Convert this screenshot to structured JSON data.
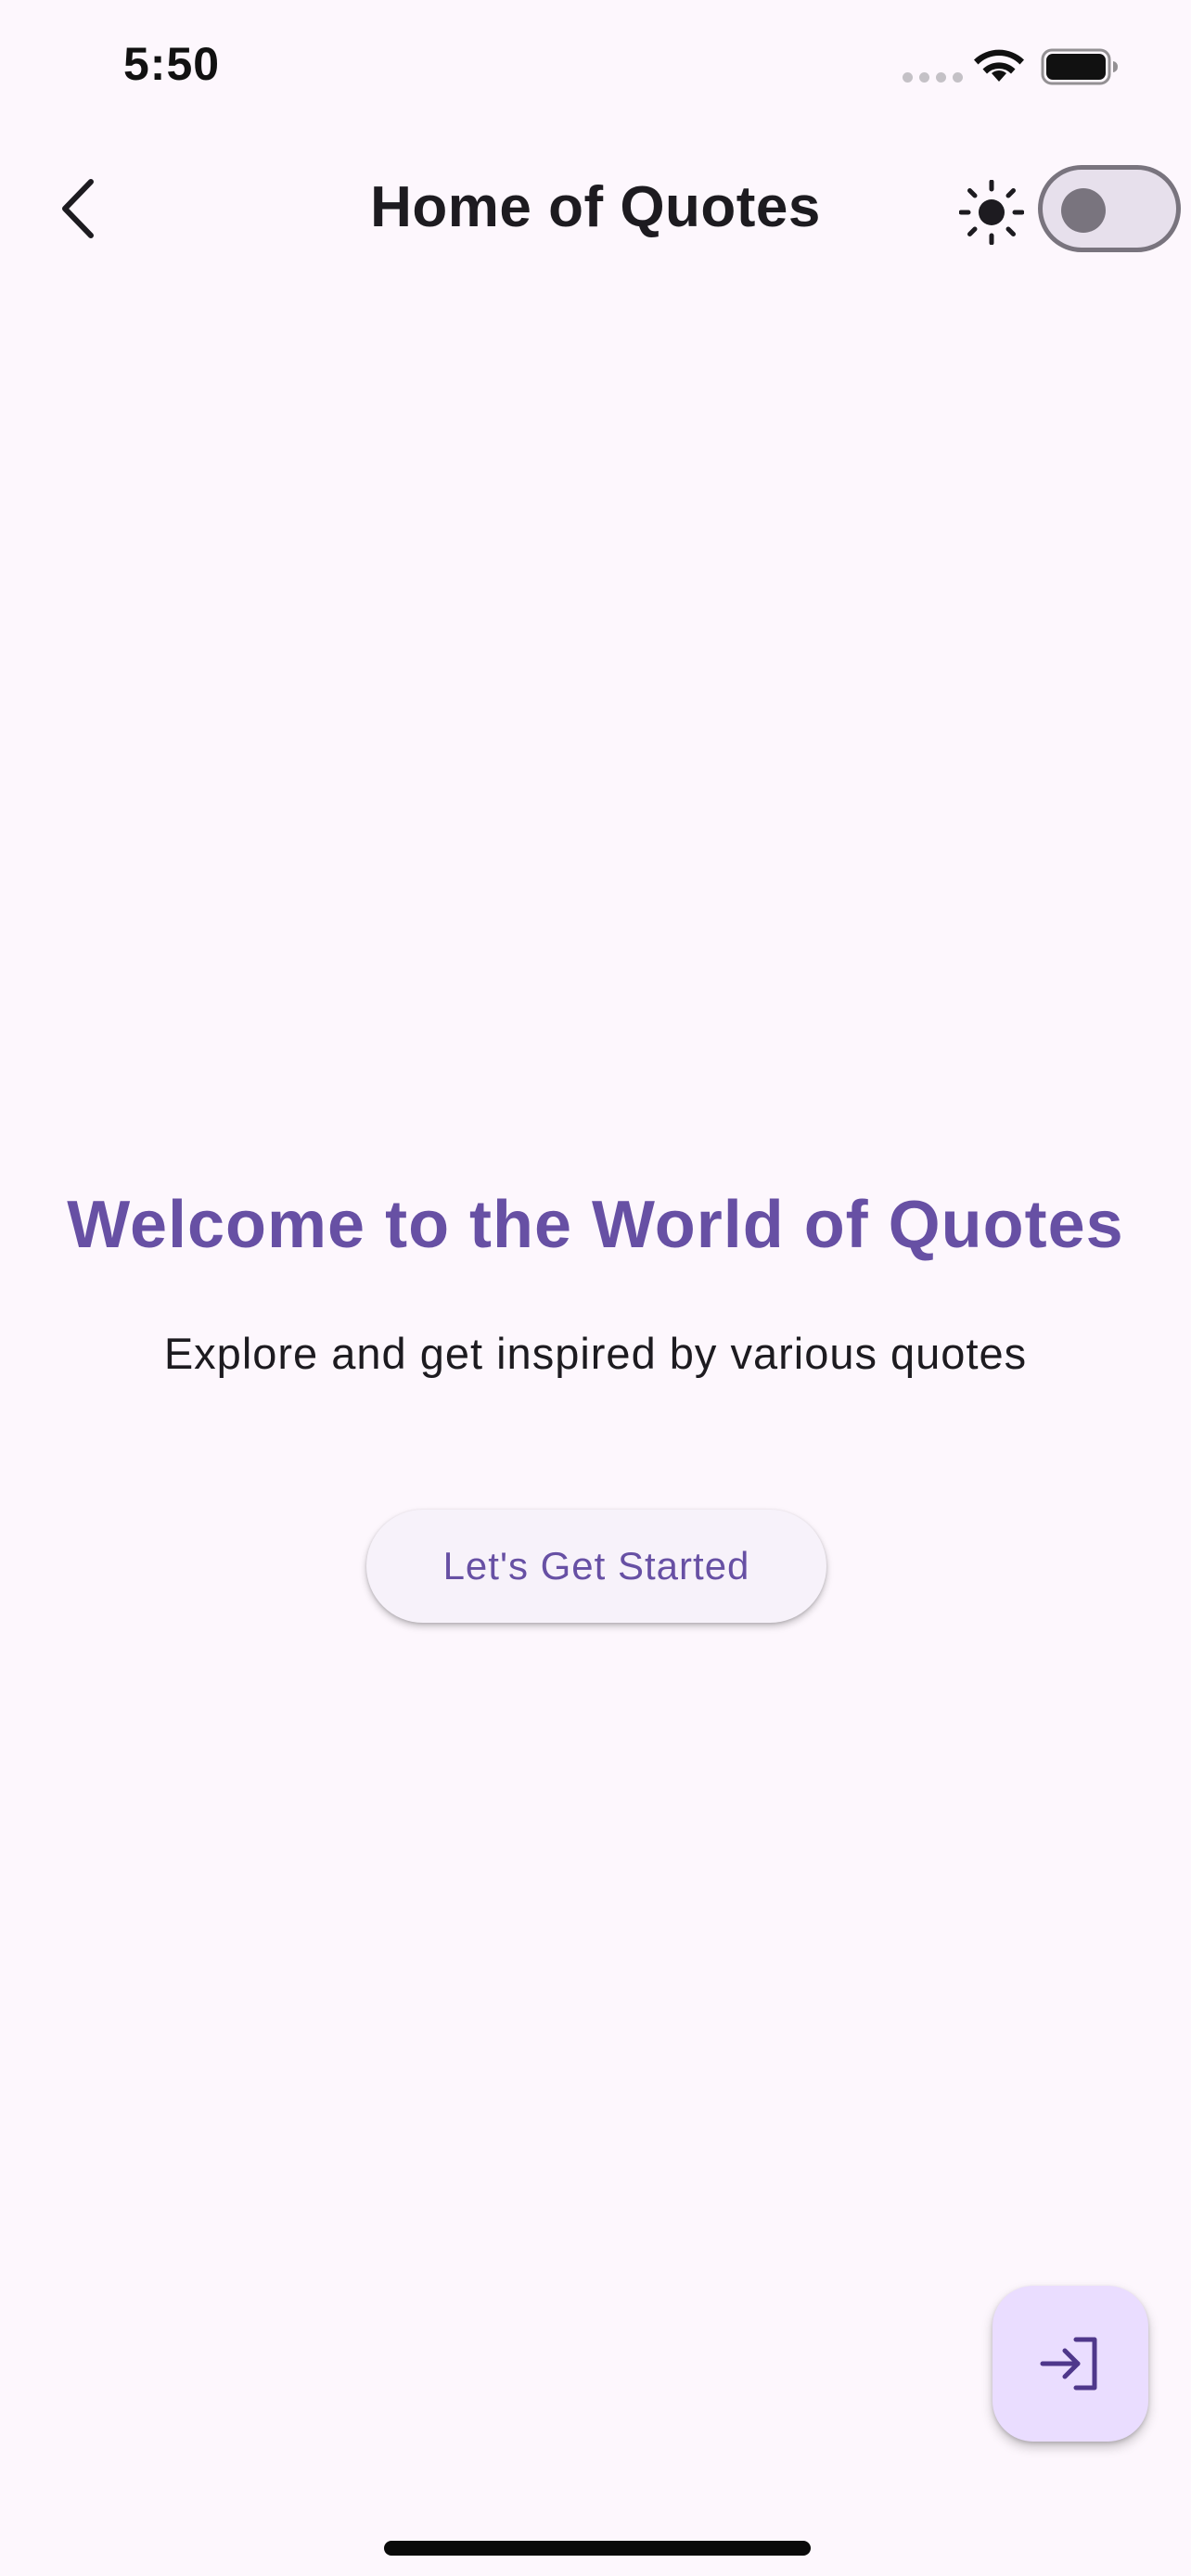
{
  "status_bar": {
    "time": "5:50"
  },
  "app_bar": {
    "title": "Home of Quotes",
    "theme_toggle_on": false
  },
  "main": {
    "welcome_title": "Welcome to the World of Quotes",
    "subtitle": "Explore and get inspired by various quotes",
    "cta_label": "Let's Get Started"
  },
  "icons": {
    "back": "chevron-left-icon",
    "theme": "sun-icon",
    "fab": "login-icon",
    "wifi": "wifi-icon",
    "battery": "battery-icon"
  },
  "colors": {
    "background": "#fdf7fd",
    "primary": "#6750a4",
    "fab_container": "#eaddff",
    "text": "#1d1b20",
    "outline": "#79747e"
  }
}
